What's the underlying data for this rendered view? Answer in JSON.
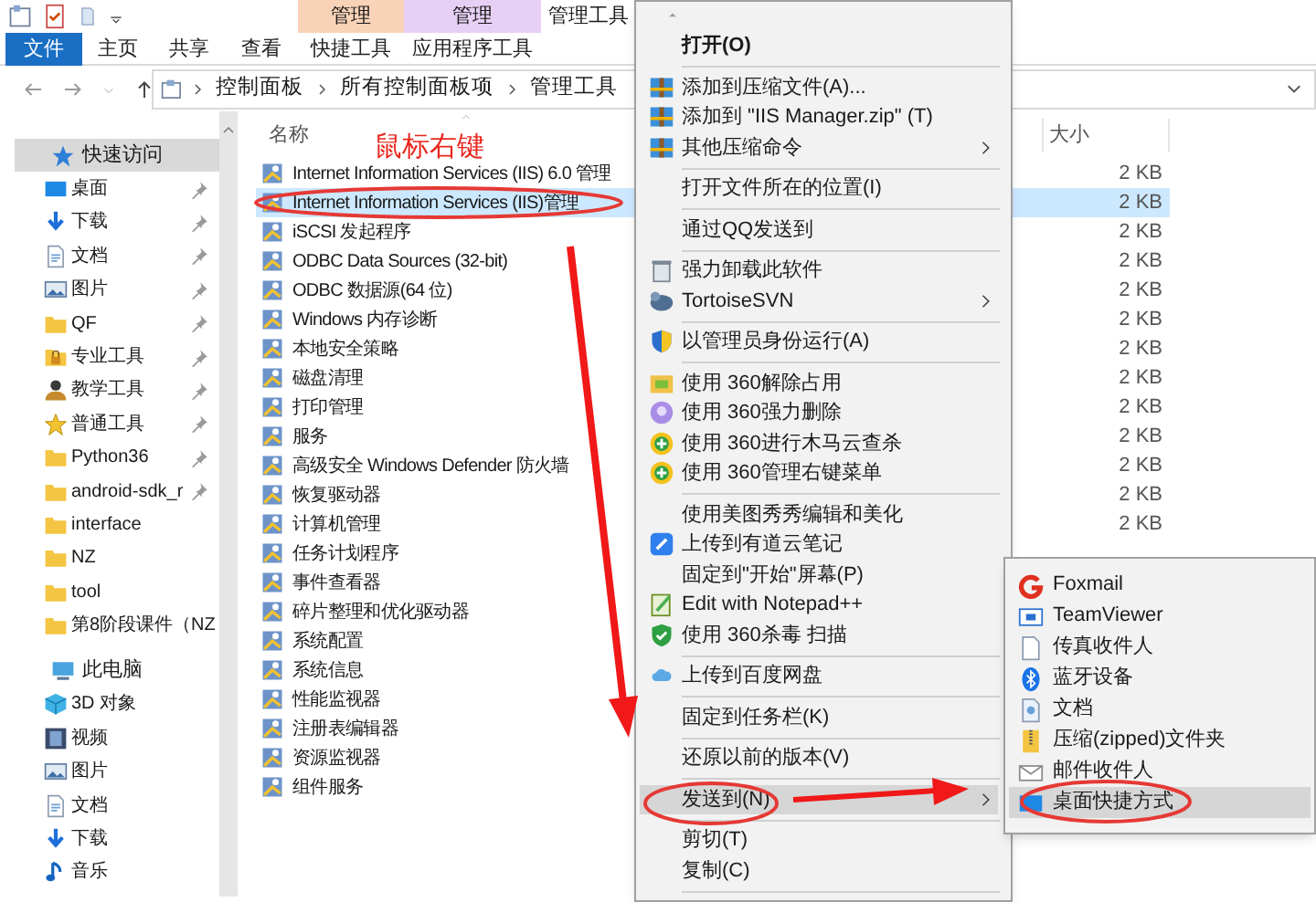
{
  "ribbon": {
    "title": "管理工具",
    "context_headers": [
      {
        "label": "管理",
        "color": "#f9d3b8"
      },
      {
        "label": "管理",
        "color": "#e7d0f5"
      }
    ],
    "tabs": [
      {
        "label": "文件",
        "kind": "file"
      },
      {
        "label": "主页",
        "kind": "tab"
      },
      {
        "label": "共享",
        "kind": "tab"
      },
      {
        "label": "查看",
        "kind": "tab"
      },
      {
        "label": "快捷工具",
        "kind": "tab"
      },
      {
        "label": "应用程序工具",
        "kind": "tab"
      }
    ]
  },
  "address_bar": {
    "path": [
      "控制面板",
      "所有控制面板项",
      "管理工具"
    ]
  },
  "sidebar": {
    "items": [
      {
        "label": "快速访问",
        "selected": true,
        "children": [
          {
            "label": "桌面",
            "pinned": true,
            "selected": false
          },
          {
            "label": "下载",
            "pinned": true,
            "selected": false
          },
          {
            "label": "文档",
            "pinned": true,
            "selected": false
          },
          {
            "label": "图片",
            "pinned": true,
            "selected": false
          },
          {
            "label": "QF",
            "pinned": true,
            "selected": false
          },
          {
            "label": "专业工具",
            "pinned": true,
            "selected": false
          },
          {
            "label": "教学工具",
            "pinned": true,
            "selected": false
          },
          {
            "label": "普通工具",
            "pinned": true,
            "selected": false
          },
          {
            "label": "Python36",
            "pinned": true,
            "selected": false
          },
          {
            "label": "android-sdk_r",
            "pinned": true,
            "selected": false
          },
          {
            "label": "interface",
            "pinned": false,
            "selected": false
          },
          {
            "label": "NZ",
            "pinned": false,
            "selected": false
          },
          {
            "label": "tool",
            "pinned": false,
            "selected": false
          },
          {
            "label": "第8阶段课件（NZ",
            "pinned": false,
            "selected": false
          }
        ]
      },
      {
        "label": "此电脑",
        "selected": false,
        "children": [
          {
            "label": "3D 对象",
            "pinned": false,
            "selected": false
          },
          {
            "label": "视频",
            "pinned": false,
            "selected": false
          },
          {
            "label": "图片",
            "pinned": false,
            "selected": false
          },
          {
            "label": "文档",
            "pinned": false,
            "selected": false
          },
          {
            "label": "下载",
            "pinned": false,
            "selected": false
          },
          {
            "label": "音乐",
            "pinned": false,
            "selected": false
          }
        ]
      }
    ]
  },
  "file_list": {
    "columns": [
      "名称",
      "大小"
    ],
    "rows": [
      {
        "name": "Internet Information Services (IIS) 6.0 管理",
        "size": "2 KB",
        "selected": false
      },
      {
        "name": "Internet Information Services (IIS)管理",
        "size": "2 KB",
        "selected": true
      },
      {
        "name": "iSCSI 发起程序",
        "size": "2 KB",
        "selected": false
      },
      {
        "name": "ODBC Data Sources (32-bit)",
        "size": "2 KB",
        "selected": false
      },
      {
        "name": "ODBC 数据源(64 位)",
        "size": "2 KB",
        "selected": false
      },
      {
        "name": "Windows 内存诊断",
        "size": "2 KB",
        "selected": false
      },
      {
        "name": "本地安全策略",
        "size": "2 KB",
        "selected": false
      },
      {
        "name": "磁盘清理",
        "size": "2 KB",
        "selected": false
      },
      {
        "name": "打印管理",
        "size": "2 KB",
        "selected": false
      },
      {
        "name": "服务",
        "size": "2 KB",
        "selected": false
      },
      {
        "name": "高级安全 Windows Defender 防火墙",
        "size": "2 KB",
        "selected": false
      },
      {
        "name": "恢复驱动器",
        "size": "2 KB",
        "selected": false
      },
      {
        "name": "计算机管理",
        "size": "2 KB",
        "selected": false
      },
      {
        "name": "任务计划程序",
        "selected": false
      },
      {
        "name": "事件查看器",
        "selected": false
      },
      {
        "name": "碎片整理和优化驱动器",
        "selected": false
      },
      {
        "name": "系统配置",
        "selected": false
      },
      {
        "name": "系统信息",
        "selected": false
      },
      {
        "name": "性能监视器",
        "selected": false
      },
      {
        "name": "注册表编辑器",
        "selected": false
      },
      {
        "name": "资源监视器",
        "selected": false
      },
      {
        "name": "组件服务",
        "selected": false
      }
    ]
  },
  "context_menu": {
    "groups": [
      [
        {
          "label": "打开(O)",
          "default": true,
          "submenu": false,
          "selected": false
        }
      ],
      [
        {
          "label": "添加到压缩文件(A)...",
          "default": false,
          "submenu": false,
          "selected": false
        },
        {
          "label": "添加到 \"IIS Manager.zip\" (T)",
          "default": false,
          "submenu": false,
          "selected": false
        },
        {
          "label": "其他压缩命令",
          "default": false,
          "submenu": true,
          "selected": false
        }
      ],
      [
        {
          "label": "打开文件所在的位置(I)",
          "default": false,
          "submenu": false,
          "selected": false
        }
      ],
      [
        {
          "label": "通过QQ发送到",
          "default": false,
          "submenu": false,
          "selected": false
        }
      ],
      [
        {
          "label": "强力卸载此软件",
          "default": false,
          "submenu": false,
          "selected": false
        },
        {
          "label": "TortoiseSVN",
          "default": false,
          "submenu": true,
          "selected": false
        }
      ],
      [
        {
          "label": "以管理员身份运行(A)",
          "default": false,
          "submenu": false,
          "selected": false
        }
      ],
      [
        {
          "label": "使用 360解除占用",
          "default": false,
          "submenu": false,
          "selected": false
        },
        {
          "label": "使用 360强力删除",
          "default": false,
          "submenu": false,
          "selected": false
        },
        {
          "label": "使用 360进行木马云查杀",
          "default": false,
          "submenu": false,
          "selected": false
        },
        {
          "label": "使用 360管理右键菜单",
          "default": false,
          "submenu": false,
          "selected": false
        }
      ],
      [
        {
          "label": "使用美图秀秀编辑和美化",
          "default": false,
          "submenu": false,
          "selected": false
        },
        {
          "label": "上传到有道云笔记",
          "default": false,
          "submenu": false,
          "selected": false
        },
        {
          "label": "固定到\"开始\"屏幕(P)",
          "default": false,
          "submenu": false,
          "selected": false
        },
        {
          "label": "Edit with Notepad++",
          "default": false,
          "submenu": false,
          "selected": false
        },
        {
          "label": "使用 360杀毒 扫描",
          "default": false,
          "submenu": false,
          "selected": false
        }
      ],
      [
        {
          "label": "上传到百度网盘",
          "default": false,
          "submenu": false,
          "selected": false
        }
      ],
      [
        {
          "label": "固定到任务栏(K)",
          "default": false,
          "submenu": false,
          "selected": false
        }
      ],
      [
        {
          "label": "还原以前的版本(V)",
          "default": false,
          "submenu": false,
          "selected": false
        }
      ],
      [
        {
          "label": "发送到(N)",
          "default": false,
          "submenu": true,
          "selected": true
        }
      ],
      [
        {
          "label": "剪切(T)",
          "default": false,
          "submenu": false,
          "selected": false
        },
        {
          "label": "复制(C)",
          "default": false,
          "submenu": false,
          "selected": false
        }
      ]
    ]
  },
  "send_to_menu": {
    "items": [
      {
        "label": "Foxmail",
        "selected": false
      },
      {
        "label": "TeamViewer",
        "selected": false
      },
      {
        "label": "传真收件人",
        "selected": false
      },
      {
        "label": "蓝牙设备",
        "selected": false
      },
      {
        "label": "文档",
        "selected": false
      },
      {
        "label": "压缩(zipped)文件夹",
        "selected": false
      },
      {
        "label": "邮件收件人",
        "selected": false
      },
      {
        "label": "桌面快捷方式",
        "selected": true
      }
    ]
  },
  "annotation": {
    "label": "鼠标右键"
  }
}
